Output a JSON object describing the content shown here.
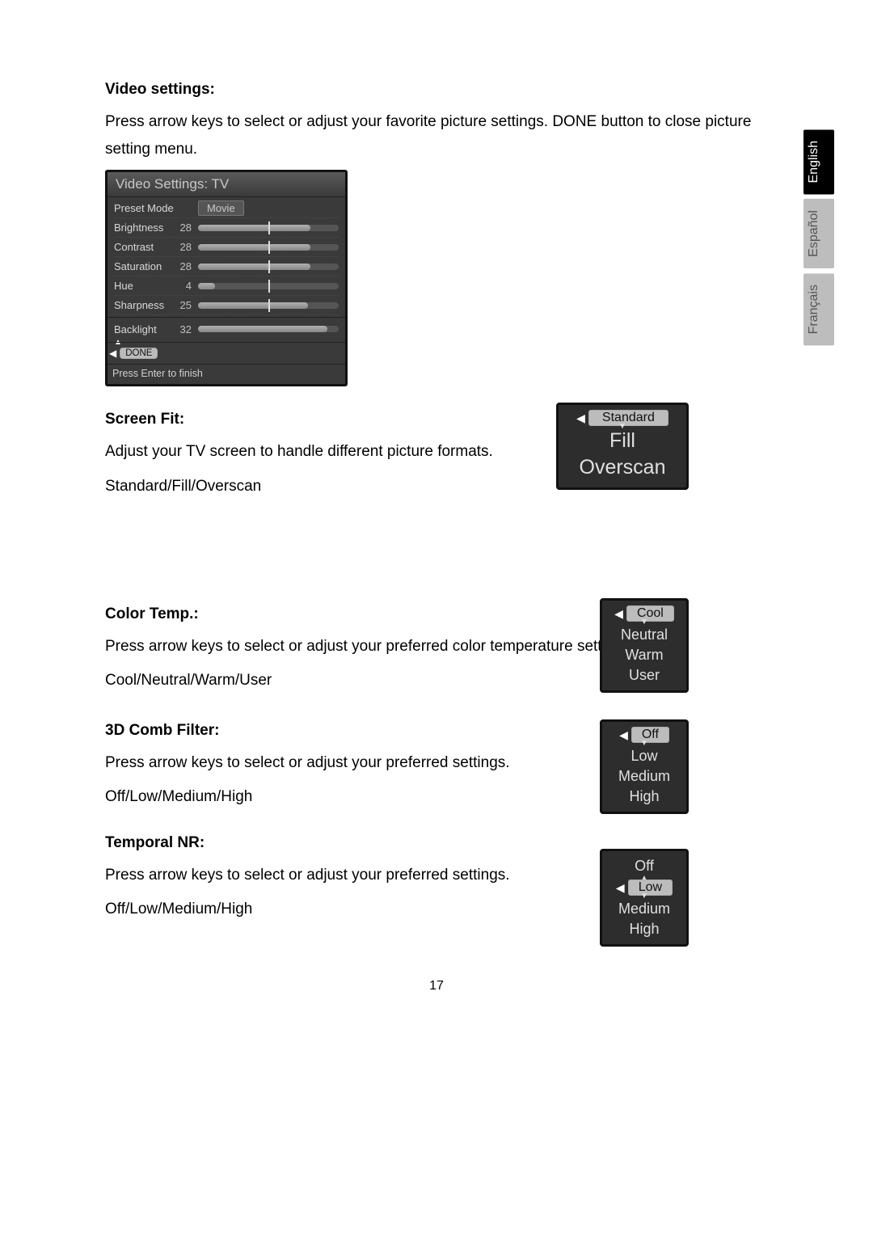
{
  "page_number": "17",
  "languages": {
    "en": "English",
    "es": "Español",
    "fr": "Français"
  },
  "sections": {
    "video_settings": {
      "title": "Video settings:",
      "body": "Press arrow keys to select or adjust your favorite picture settings. DONE button to close picture setting menu."
    },
    "screen_fit": {
      "title": "Screen Fit:",
      "body_line1": "Adjust your TV screen to handle different picture formats.",
      "body_line2": "Standard/Fill/Overscan"
    },
    "color_temp": {
      "title": "Color Temp.:",
      "body_line1": "Press arrow keys to select or adjust your preferred color temperature settings.",
      "body_line2": "Cool/Neutral/Warm/User"
    },
    "comb_filter": {
      "title": "3D Comb Filter:",
      "body_line1": "Press arrow keys to select or adjust your preferred settings.",
      "body_line2": "Off/Low/Medium/High"
    },
    "temporal_nr": {
      "title": "Temporal NR:",
      "body_line1": "Press arrow keys to select or adjust your preferred settings.",
      "body_line2": "Off/Low/Medium/High"
    }
  },
  "video_settings_panel": {
    "header": "Video Settings: TV",
    "preset_label": "Preset Mode",
    "preset_value": "Movie",
    "rows": {
      "brightness": {
        "label": "Brightness",
        "value": "28"
      },
      "contrast": {
        "label": "Contrast",
        "value": "28"
      },
      "saturation": {
        "label": "Saturation",
        "value": "28"
      },
      "hue": {
        "label": "Hue",
        "value": "4"
      },
      "sharpness": {
        "label": "Sharpness",
        "value": "25"
      },
      "backlight": {
        "label": "Backlight",
        "value": "32"
      }
    },
    "done_label": "DONE",
    "footer": "Press Enter to finish"
  },
  "option_menus": {
    "screen_fit": {
      "selected": "Standard",
      "o1": "Fill",
      "o2": "Overscan"
    },
    "color_temp": {
      "selected": "Cool",
      "o1": "Neutral",
      "o2": "Warm",
      "o3": "User"
    },
    "comb": {
      "selected": "Off",
      "o1": "Low",
      "o2": "Medium",
      "o3": "High"
    },
    "temporal": {
      "above": "Off",
      "selected": "Low",
      "o1": "Medium",
      "o2": "High"
    }
  }
}
